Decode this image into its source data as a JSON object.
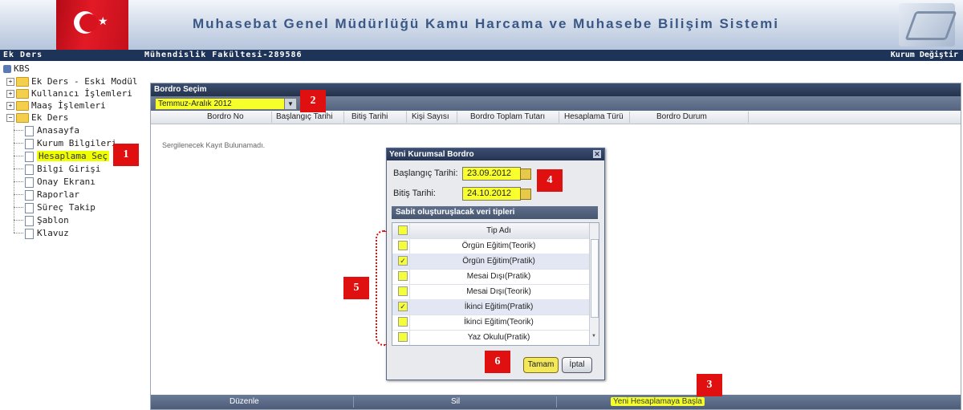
{
  "header": {
    "title": "Muhasebat Genel Müdürlüğü Kamu Harcama ve Muhasebe Bilişim Sistemi"
  },
  "topbar": {
    "module": "Ek Ders",
    "institution": "Mühendislik Fakültesi-289586",
    "change_institution": "Kurum Değiştir"
  },
  "tree": {
    "root": "KBS",
    "folders": [
      "Ek Ders - Eski Modül",
      "Kullanıcı İşlemleri",
      "Maaş İşlemleri",
      "Ek Ders"
    ],
    "items": [
      "Anasayfa",
      "Kurum Bilgileri",
      "Hesaplama Seç",
      "Bilgi Girişi",
      "Onay Ekranı",
      "Raporlar",
      "Süreç Takip",
      "Şablon",
      "Klavuz"
    ]
  },
  "panel": {
    "title": "Bordro Seçim",
    "period_select": "Temmuz-Aralık 2012",
    "columns": [
      "Bordro No",
      "Başlangıç Tarihi",
      "Bitiş Tarihi",
      "Kişi Sayısı",
      "Bordro Toplam Tutarı",
      "Hesaplama Türü",
      "Bordro Durum"
    ],
    "empty_message": "Sergilenecek Kayıt Bulunamadı.",
    "bottom_actions": [
      "Düzenle",
      "Sil",
      "Yeni Hesaplamaya Başla"
    ]
  },
  "dialog": {
    "title": "Yeni Kurumsal Bordro",
    "start_label": "Başlangıç Tarihi:",
    "start_value": "23.09.2012",
    "end_label": "Bitiş Tarihi:",
    "end_value": "24.10.2012",
    "section_title": "Sabit oluşturuşlacak veri tipleri",
    "grid_header": "Tip Adı",
    "types": [
      {
        "name": "Örgün Eğitim(Teorik)",
        "checked": false
      },
      {
        "name": "Örgün Eğitim(Pratik)",
        "checked": true
      },
      {
        "name": "Mesai Dışı(Pratik)",
        "checked": false
      },
      {
        "name": "Mesai Dışı(Teorik)",
        "checked": false
      },
      {
        "name": "İkinci Eğitim(Pratik)",
        "checked": true
      },
      {
        "name": "İkinci Eğitim(Teorik)",
        "checked": false
      },
      {
        "name": "Yaz Okulu(Pratik)",
        "checked": false
      }
    ],
    "ok_label": "Tamam",
    "cancel_label": "İptal"
  },
  "annotations": [
    "1",
    "2",
    "3",
    "4",
    "5",
    "6"
  ],
  "colors": {
    "highlight": "#f5ff2a",
    "badge": "#e11010",
    "header_dark": "#1e3358"
  }
}
